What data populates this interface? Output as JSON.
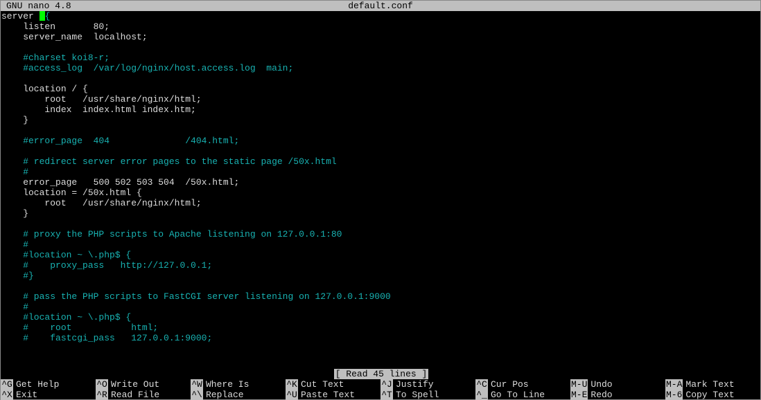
{
  "titlebar": {
    "app": "GNU nano 4.8",
    "filename": "default.conf"
  },
  "editor_lines": [
    {
      "cls": "white",
      "text": "server ",
      "cursor_after": true,
      "suffix_cls": "comment",
      "suffix": "{"
    },
    {
      "cls": "white",
      "text": "    listen       80;"
    },
    {
      "cls": "white",
      "text": "    server_name  localhost;"
    },
    {
      "cls": "white",
      "text": ""
    },
    {
      "cls": "comment",
      "text": "    #charset koi8-r;"
    },
    {
      "cls": "comment",
      "text": "    #access_log  /var/log/nginx/host.access.log  main;"
    },
    {
      "cls": "white",
      "text": ""
    },
    {
      "cls": "white",
      "text": "    location / {"
    },
    {
      "cls": "white",
      "text": "        root   /usr/share/nginx/html;"
    },
    {
      "cls": "white",
      "text": "        index  index.html index.htm;"
    },
    {
      "cls": "white",
      "text": "    }"
    },
    {
      "cls": "white",
      "text": ""
    },
    {
      "cls": "comment",
      "text": "    #error_page  404              /404.html;"
    },
    {
      "cls": "white",
      "text": ""
    },
    {
      "cls": "comment",
      "text": "    # redirect server error pages to the static page /50x.html"
    },
    {
      "cls": "comment",
      "text": "    #"
    },
    {
      "cls": "white",
      "text": "    error_page   500 502 503 504  /50x.html;"
    },
    {
      "cls": "white",
      "text": "    location = /50x.html {"
    },
    {
      "cls": "white",
      "text": "        root   /usr/share/nginx/html;"
    },
    {
      "cls": "white",
      "text": "    }"
    },
    {
      "cls": "white",
      "text": ""
    },
    {
      "cls": "comment",
      "text": "    # proxy the PHP scripts to Apache listening on 127.0.0.1:80"
    },
    {
      "cls": "comment",
      "text": "    #"
    },
    {
      "cls": "comment",
      "text": "    #location ~ \\.php$ {"
    },
    {
      "cls": "comment",
      "text": "    #    proxy_pass   http://127.0.0.1;"
    },
    {
      "cls": "comment",
      "text": "    #}"
    },
    {
      "cls": "white",
      "text": ""
    },
    {
      "cls": "comment",
      "text": "    # pass the PHP scripts to FastCGI server listening on 127.0.0.1:9000"
    },
    {
      "cls": "comment",
      "text": "    #"
    },
    {
      "cls": "comment",
      "text": "    #location ~ \\.php$ {"
    },
    {
      "cls": "comment",
      "text": "    #    root           html;"
    },
    {
      "cls": "comment",
      "text": "    #    fastcgi_pass   127.0.0.1:9000;"
    }
  ],
  "status": "[ Read 45 lines ]",
  "shortcuts": {
    "row1": [
      {
        "key": "^G",
        "label": "Get Help"
      },
      {
        "key": "^O",
        "label": "Write Out"
      },
      {
        "key": "^W",
        "label": "Where Is"
      },
      {
        "key": "^K",
        "label": "Cut Text"
      },
      {
        "key": "^J",
        "label": "Justify"
      },
      {
        "key": "^C",
        "label": "Cur Pos"
      },
      {
        "key": "M-U",
        "label": "Undo"
      },
      {
        "key": "M-A",
        "label": "Mark Text"
      }
    ],
    "row2": [
      {
        "key": "^X",
        "label": "Exit"
      },
      {
        "key": "^R",
        "label": "Read File"
      },
      {
        "key": "^\\",
        "label": "Replace"
      },
      {
        "key": "^U",
        "label": "Paste Text"
      },
      {
        "key": "^T",
        "label": "To Spell"
      },
      {
        "key": "^_",
        "label": "Go To Line"
      },
      {
        "key": "M-E",
        "label": "Redo"
      },
      {
        "key": "M-6",
        "label": "Copy Text"
      }
    ]
  }
}
